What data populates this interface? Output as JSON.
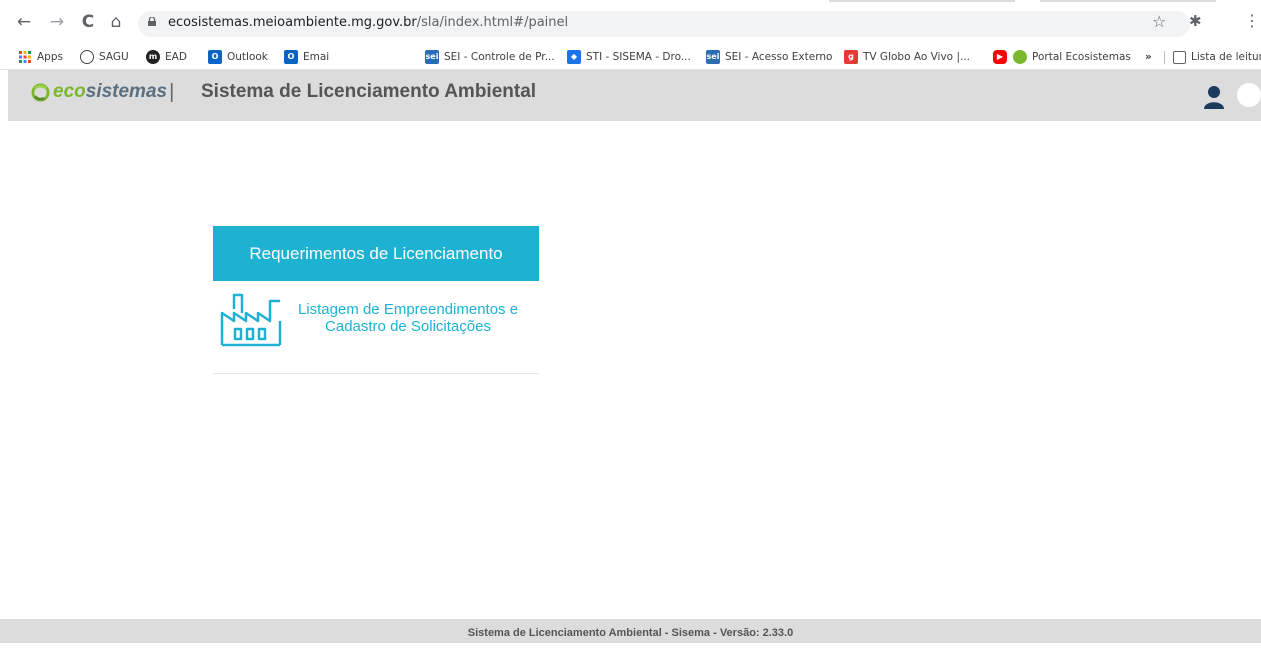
{
  "browser": {
    "url_host": "ecosistemas.meioambiente.mg.gov.br",
    "url_path": "/sla/index.html#/painel",
    "nav": {
      "back": "←",
      "forward": "→",
      "reload": "C",
      "home": "⌂"
    }
  },
  "bookmarks": [
    {
      "label": "Apps",
      "icon": "apps-grid-icon"
    },
    {
      "label": "SAGU",
      "icon": "sagu-icon"
    },
    {
      "label": "EAD",
      "icon": "ead-icon"
    },
    {
      "label": "Outlook",
      "icon": "outlook-icon"
    },
    {
      "label": "Emai",
      "icon": "outlook-icon"
    },
    {
      "label": "SEI - Controle de Pr...",
      "icon": "sei-icon"
    },
    {
      "label": "STI - SISEMA - Dro...",
      "icon": "dropbox-icon"
    },
    {
      "label": "SEI - Acesso Externo",
      "icon": "sei-icon"
    },
    {
      "label": "TV Globo Ao Vivo |...",
      "icon": "globo-icon"
    },
    {
      "label": "",
      "icon": "youtube-icon"
    },
    {
      "label": "Portal Ecosistemas",
      "icon": "ecosistemas-icon"
    },
    {
      "label": "»",
      "icon": ""
    },
    {
      "label": "Lista de leitur",
      "icon": "reading-list-icon"
    }
  ],
  "header": {
    "logo_eco": "eco",
    "logo_sistemas": "sistemas",
    "logo_bar": "|",
    "title": "Sistema de Licenciamento Ambiental"
  },
  "card": {
    "header": "Requerimentos de Licenciamento",
    "link_line1": "Listagem de Empreendimentos e",
    "link_line2": "Cadastro de Solicitações"
  },
  "footer": {
    "text": "Sistema de Licenciamento Ambiental - Sisema - Versão: 2.33.0"
  },
  "colors": {
    "accent": "#1eb2d2",
    "header_bg": "#dcdcdc",
    "logo_green": "#7cb82f",
    "logo_slate": "#5b6f80"
  }
}
